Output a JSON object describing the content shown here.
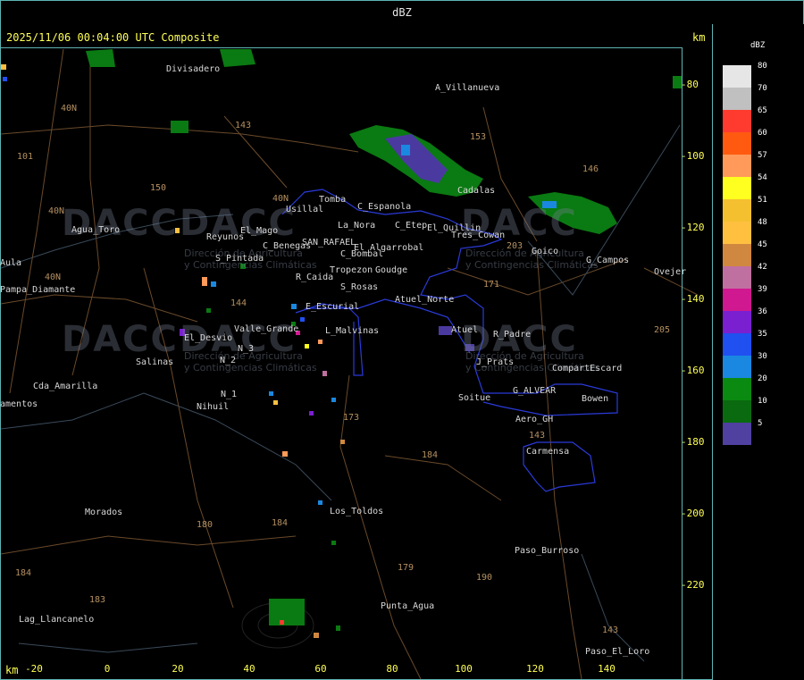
{
  "window": {
    "title": "dBZ"
  },
  "map": {
    "timestamp": "2025/11/06 00:04:00 UTC Composite",
    "unit_top": "km",
    "unit_bottom": "km",
    "y_ticks": [
      "-80",
      "-100",
      "-120",
      "-140",
      "-160",
      "-180",
      "-200",
      "-220"
    ],
    "x_ticks": [
      "-20",
      "0",
      "20",
      "40",
      "60",
      "80",
      "100",
      "120",
      "140"
    ],
    "places": [
      "Divisadero",
      "A_Villanueva",
      "Usillal",
      "Tomba",
      "La_Nora",
      "C_Espanola",
      "C_Etep",
      "El_Quillin",
      "Tres_Cowan",
      "Goico",
      "G_Campos",
      "Ovejer",
      "Reyunos",
      "Agua_Toro",
      "El_Mago",
      "C_Benegas",
      "SAN_RAFAEL",
      "El_Algarrobal",
      "C_Bombal",
      "S_Pintada",
      "Tropezon",
      "Goudge",
      "R_Caida",
      "S_Rosas",
      "Atuel_Norte",
      "E_Escurial",
      "Valle_Grande",
      "L_Malvinas",
      "El_Desvio",
      "Atuel",
      "R_Padre",
      "Salinas",
      "N_3",
      "N_2",
      "J_Prats",
      "CompartEscard",
      "Cda_Amarilla",
      "N_1",
      "G_ALVEAR",
      "Soitue",
      "Bowen",
      "Nihuil",
      "Aero_GH",
      "Carmensa",
      "Morados",
      "Los_Toldos",
      "Paso_Burroso",
      "Punta_Agua",
      "Lag_Llancanelo",
      "Paso_El_Loro",
      "Pampa_Diamante",
      "Aula",
      "amentos",
      "Cadalas"
    ],
    "roads": [
      "40N",
      "40N",
      "40N",
      "101",
      "143",
      "150",
      "153",
      "146",
      "203",
      "171",
      "143",
      "144",
      "173",
      "184",
      "180",
      "184",
      "179",
      "190",
      "184",
      "183",
      "143",
      "205",
      "40N"
    ],
    "watermark": {
      "brand": "DACC",
      "line1": "Dirección de Agricultura",
      "line2": "y Contingencias Climáticas"
    }
  },
  "legend": {
    "title": "dBZ",
    "items": [
      {
        "label": "80",
        "color": "#e6e6e6"
      },
      {
        "label": "70",
        "color": "#c0c0c0"
      },
      {
        "label": "65",
        "color": "#ff3b2f"
      },
      {
        "label": "60",
        "color": "#ff5a10"
      },
      {
        "label": "57",
        "color": "#ff9a5a"
      },
      {
        "label": "54",
        "color": "#ffff20"
      },
      {
        "label": "51",
        "color": "#f5c030"
      },
      {
        "label": "48",
        "color": "#ffc040"
      },
      {
        "label": "45",
        "color": "#d08840"
      },
      {
        "label": "42",
        "color": "#c070a0"
      },
      {
        "label": "39",
        "color": "#d01890"
      },
      {
        "label": "36",
        "color": "#7a20d0"
      },
      {
        "label": "35",
        "color": "#2050f0"
      },
      {
        "label": "30",
        "color": "#1a88e0"
      },
      {
        "label": "20",
        "color": "#0a8a10"
      },
      {
        "label": "10",
        "color": "#0a6a10"
      },
      {
        "label": "5",
        "color": "#5040a0"
      }
    ]
  }
}
